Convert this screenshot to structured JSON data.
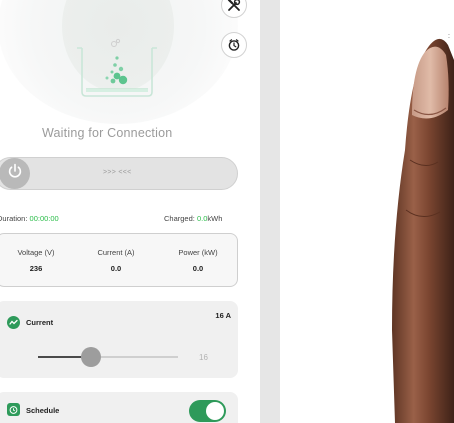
{
  "status": {
    "text": "Waiting for Connection"
  },
  "slide_control": {
    "hint": ">>> <<<"
  },
  "session": {
    "duration_label": "Duration:",
    "duration_value": "00:00:00",
    "charged_label": "Charged:",
    "charged_value": "0.0",
    "charged_unit": "kWh"
  },
  "metrics": [
    {
      "label": "Voltage (V)",
      "value": "236"
    },
    {
      "label": "Current (A)",
      "value": "0.0"
    },
    {
      "label": "Power (kW)",
      "value": "0.0"
    }
  ],
  "current_card": {
    "title": "Current",
    "value_label": "16 A",
    "slider_value": 16,
    "slider_fraction": 0.38,
    "slider_end_label": "16"
  },
  "schedule_card": {
    "title": "Schedule",
    "toggle_on": true
  },
  "icons": {
    "tools_button": "tools-icon",
    "timer_button": "timer-icon",
    "power_knob": "power-icon",
    "current_card": "wave-icon",
    "schedule_card": "alarm-clock-icon",
    "charger_visual": "charging-beaker-icon"
  },
  "colors": {
    "accent_green": "#2bbd4a",
    "toggle_green": "#2e9a5a",
    "status_gray": "#9b9b9b"
  }
}
